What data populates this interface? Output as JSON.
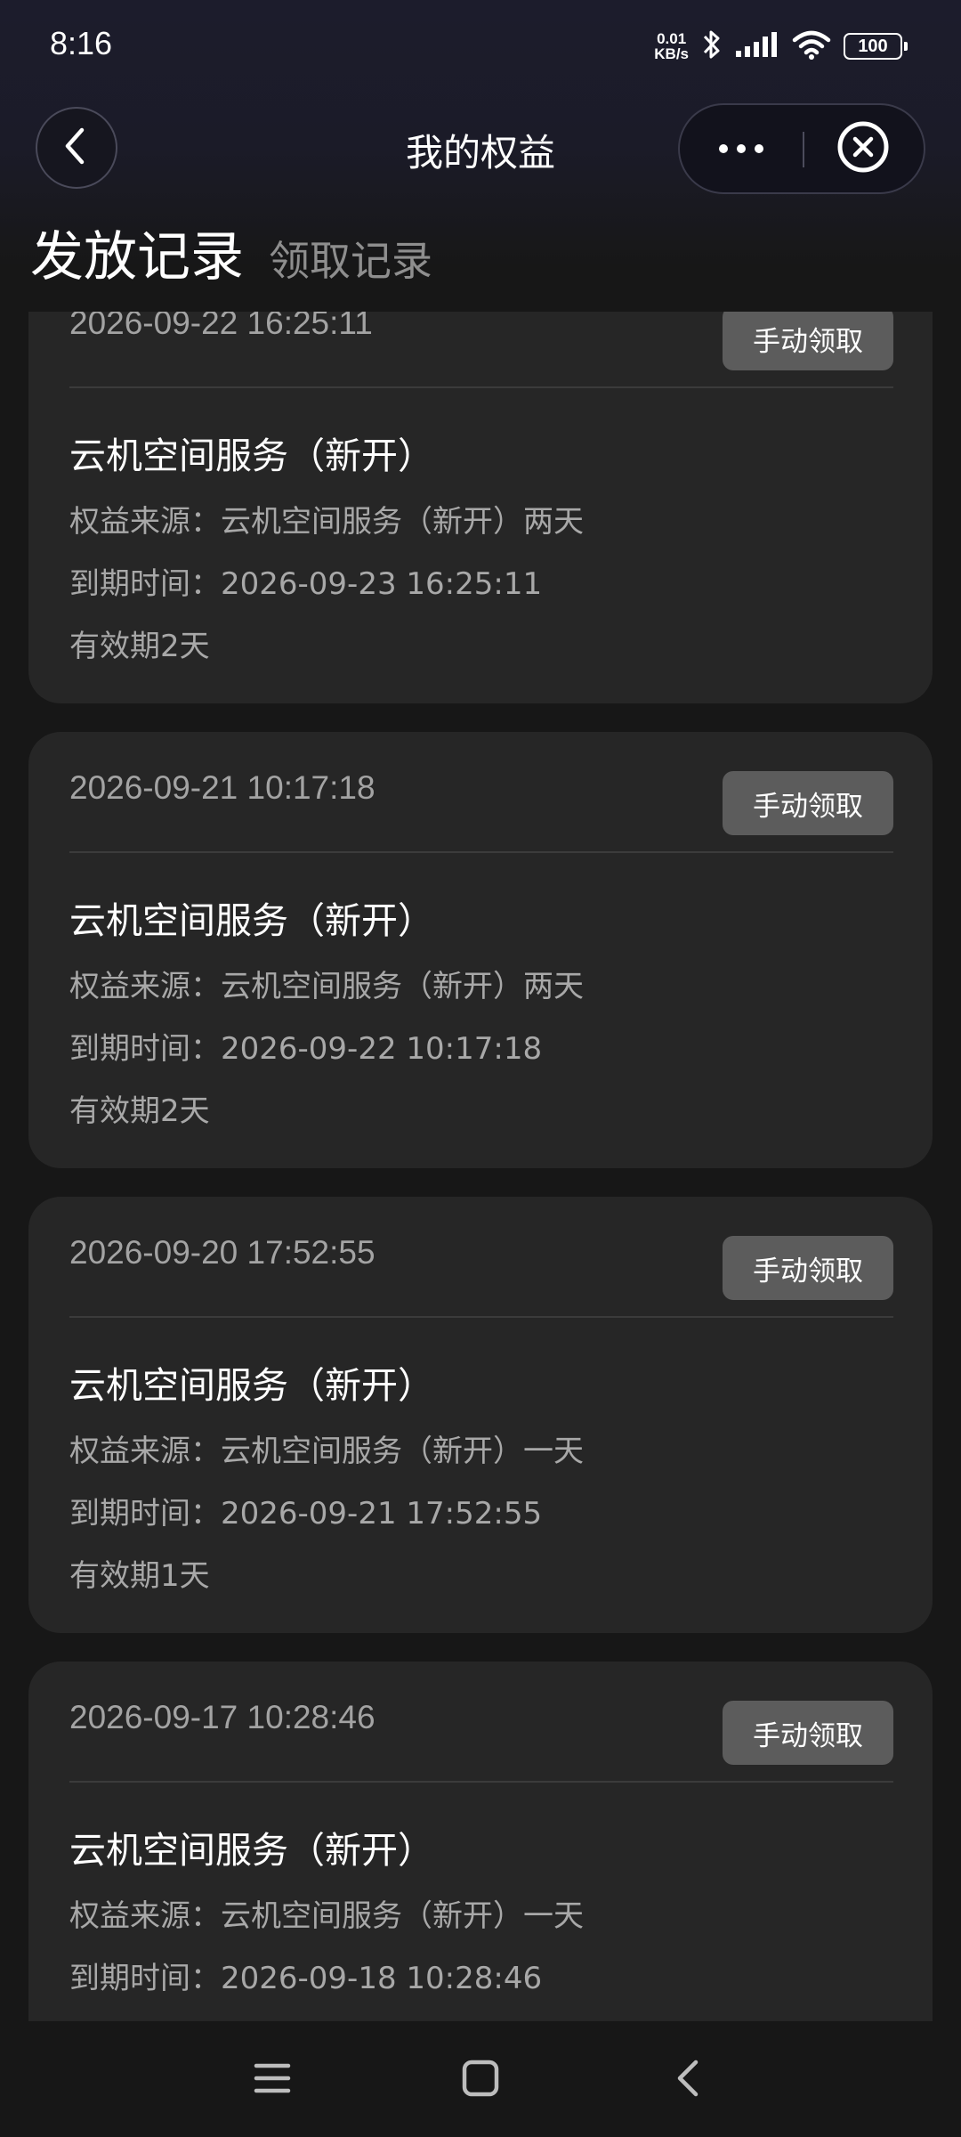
{
  "status_bar": {
    "time": "8:16",
    "net_speed_value": "0.01",
    "net_speed_unit": "KB/s",
    "battery": "100",
    "icons": [
      "bluetooth-icon",
      "signal-icon",
      "wifi-icon",
      "battery-icon"
    ]
  },
  "nav": {
    "title": "我的权益",
    "back_icon": "chevron-left-icon",
    "more_icon": "more-dots-icon",
    "close_icon": "close-circle-icon"
  },
  "tabs": [
    {
      "label": "发放记录",
      "active": true
    },
    {
      "label": "领取记录",
      "active": false
    }
  ],
  "records": [
    {
      "date": "2026-09-22 16:25:11",
      "button": "手动领取",
      "name": "云机空间服务（新开）",
      "source": "权益来源：云机空间服务（新开）两天",
      "expire": "到期时间：2026-09-23 16:25:11",
      "validity": "有效期2天"
    },
    {
      "date": "2026-09-21 10:17:18",
      "button": "手动领取",
      "name": "云机空间服务（新开）",
      "source": "权益来源：云机空间服务（新开）两天",
      "expire": "到期时间：2026-09-22 10:17:18",
      "validity": "有效期2天"
    },
    {
      "date": "2026-09-20 17:52:55",
      "button": "手动领取",
      "name": "云机空间服务（新开）",
      "source": "权益来源：云机空间服务（新开）一天",
      "expire": "到期时间：2026-09-21 17:52:55",
      "validity": "有效期1天"
    },
    {
      "date": "2026-09-17 10:28:46",
      "button": "手动领取",
      "name": "云机空间服务（新开）",
      "source": "权益来源：云机空间服务（新开）一天",
      "expire": "到期时间：2026-09-18 10:28:46",
      "validity": ""
    }
  ],
  "system_nav": [
    "menu-icon",
    "home-square-icon",
    "back-chevron-icon"
  ],
  "colors": {
    "background": "#171717",
    "header": "#1c1c2c",
    "card": "#262626",
    "button": "#5c5c5c",
    "secondary_text": "#a8a8a8"
  }
}
